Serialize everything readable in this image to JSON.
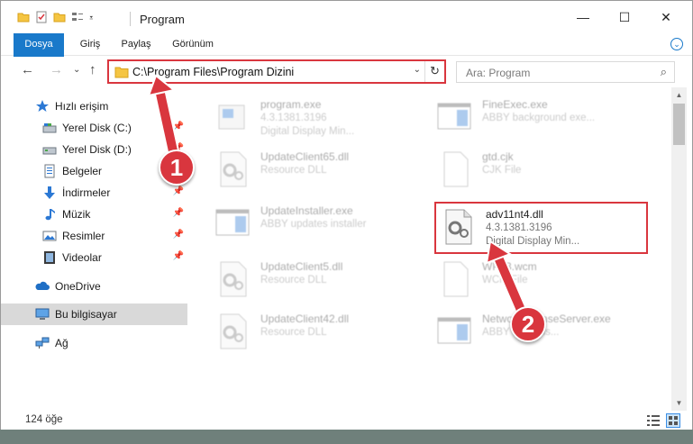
{
  "window": {
    "title": "Program",
    "minimize_glyph": "—",
    "maximize_glyph": "☐",
    "close_glyph": "✕"
  },
  "ribbon": {
    "tabs": [
      "Dosya",
      "Giriş",
      "Paylaş",
      "Görünüm"
    ],
    "expand_glyph": "⌄"
  },
  "nav": {
    "back_glyph": "←",
    "forward_glyph": "→",
    "recent_glyph": "⌄",
    "up_glyph": "↑",
    "address": "C:\\Program Files\\Program Dizini",
    "dropdown_glyph": "⌄",
    "refresh_glyph": "↻",
    "search_placeholder": "Ara: Program",
    "search_icon": "⌕"
  },
  "sidebar": {
    "items": [
      {
        "label": "Hızlı erişim",
        "icon": "star-icon",
        "pinned": false
      },
      {
        "label": "Yerel Disk (C:)",
        "icon": "drive-icon",
        "pinned": true
      },
      {
        "label": "Yerel Disk (D:)",
        "icon": "drive-icon",
        "pinned": true
      },
      {
        "label": "Belgeler",
        "icon": "document-icon",
        "pinned": true
      },
      {
        "label": "İndirmeler",
        "icon": "download-icon",
        "pinned": true
      },
      {
        "label": "Müzik",
        "icon": "music-icon",
        "pinned": true
      },
      {
        "label": "Resimler",
        "icon": "pictures-icon",
        "pinned": true
      },
      {
        "label": "Videolar",
        "icon": "video-icon",
        "pinned": true
      },
      {
        "label": "OneDrive",
        "icon": "cloud-icon",
        "pinned": false
      },
      {
        "label": "Bu bilgisayar",
        "icon": "computer-icon",
        "pinned": false,
        "selected": true
      },
      {
        "label": "Ağ",
        "icon": "network-icon",
        "pinned": false
      }
    ],
    "pin_glyph": "📌"
  },
  "files": [
    {
      "name": "program.exe",
      "line1": "4.3.1381.3196",
      "line2": "Digital Display Min...",
      "kind": "app-icon",
      "faded": true
    },
    {
      "name": "FineExec.exe",
      "line1": "ABBY background exe...",
      "line2": "",
      "kind": "window-app-icon",
      "faded": true
    },
    {
      "name": "UpdateClient65.dll",
      "line1": "Resource DLL",
      "line2": "",
      "kind": "dll-icon",
      "faded": true
    },
    {
      "name": "gtd.cjk",
      "line1": "CJK File",
      "line2": "",
      "kind": "blank-file-icon",
      "faded": true
    },
    {
      "name": "UpdateInstaller.exe",
      "line1": "ABBY updates installer",
      "line2": "",
      "kind": "window-app-icon",
      "faded": true
    },
    {
      "name": "adv11nt4.dll",
      "line1": "4.3.1381.3196",
      "line2": "Digital Display Min...",
      "kind": "dll-icon",
      "faded": false
    },
    {
      "name": "UpdateClient5.dll",
      "line1": "Resource DLL",
      "line2": "",
      "kind": "dll-icon",
      "faded": true
    },
    {
      "name": "WP13.wcm",
      "line1": "WCM File",
      "line2": "",
      "kind": "blank-file-icon",
      "faded": true
    },
    {
      "name": "UpdateClient42.dll",
      "line1": "Resource DLL",
      "line2": "",
      "kind": "dll-icon",
      "faded": true
    },
    {
      "name": "NetworkLicenseServer.exe",
      "line1": "ABBY ... licens...",
      "line2": "",
      "kind": "window-app-icon",
      "faded": true
    }
  ],
  "status": {
    "count": "124 öğe"
  },
  "callouts": [
    "1",
    "2"
  ],
  "colors": {
    "accent": "#1979ca",
    "highlight": "#d9363e"
  }
}
